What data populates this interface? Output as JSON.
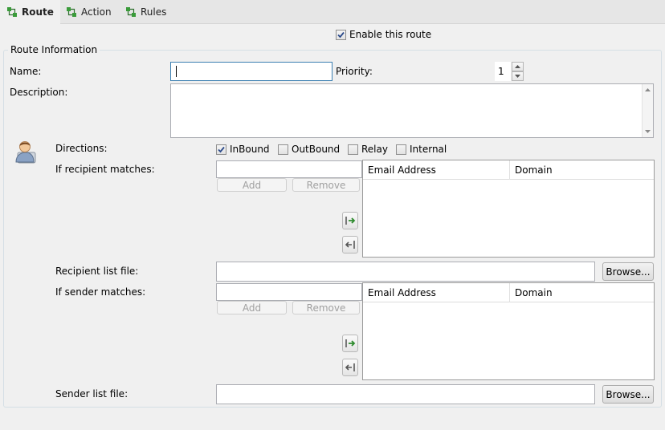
{
  "tabs": [
    {
      "label": "Route",
      "active": true
    },
    {
      "label": "Action",
      "active": false
    },
    {
      "label": "Rules",
      "active": false
    }
  ],
  "enable_route": {
    "label": "Enable this route",
    "checked": true
  },
  "group_title": "Route Information",
  "name": {
    "label": "Name:",
    "value": ""
  },
  "priority": {
    "label": "Priority:",
    "value": "1"
  },
  "description": {
    "label": "Description:",
    "value": ""
  },
  "directions": {
    "label": "Directions:",
    "options": [
      {
        "label": "InBound",
        "checked": true
      },
      {
        "label": "OutBound",
        "checked": false
      },
      {
        "label": "Relay",
        "checked": false
      },
      {
        "label": "Internal",
        "checked": false
      }
    ]
  },
  "recipient": {
    "label": "If recipient matches:",
    "input_value": "",
    "add_label": "Add",
    "remove_label": "Remove",
    "columns": [
      "Email Address",
      "Domain"
    ],
    "list_file_label": "Recipient list file:",
    "list_file_value": "",
    "browse_label": "Browse..."
  },
  "sender": {
    "label": "If sender matches:",
    "input_value": "",
    "add_label": "Add",
    "remove_label": "Remove",
    "columns": [
      "Email Address",
      "Domain"
    ],
    "list_file_label": "Sender list file:",
    "list_file_value": "",
    "browse_label": "Browse..."
  },
  "colors": {
    "accent": "#3c7fb1",
    "tab_icon": "#3a9b3a"
  },
  "icons": {
    "tab": "route-node-icon",
    "user": "user-avatar-icon",
    "move_right": "arrow-right-icon",
    "move_left": "arrow-left-icon"
  }
}
